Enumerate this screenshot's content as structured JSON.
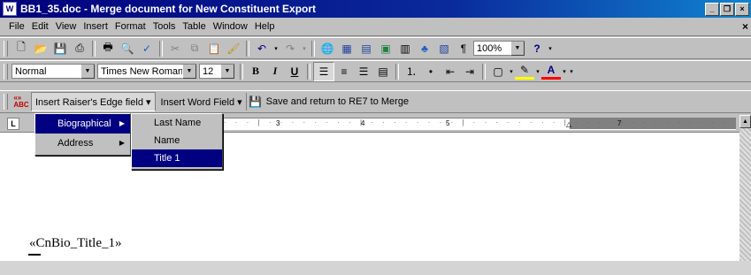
{
  "window": {
    "title": "BB1_35.doc - Merge document for New Constituent Export",
    "app_icon": "W",
    "minimize": "_",
    "maximize": " ",
    "restore": "❐",
    "close": "×"
  },
  "menubar": {
    "items": [
      "File",
      "Edit",
      "View",
      "Insert",
      "Format",
      "Tools",
      "Table",
      "Window",
      "Help"
    ],
    "close": "×"
  },
  "standard_toolbar": {
    "zoom": "100%"
  },
  "formatting_toolbar": {
    "style": "Normal",
    "font": "Times New Roman",
    "size": "12",
    "bold": "B",
    "italic": "I",
    "underline": "U"
  },
  "merge_toolbar": {
    "insert_raisers_edge_field": "Insert Raiser's Edge field ▾",
    "insert_word_field": "Insert Word Field ▾",
    "save_return": "Save and return to RE7 to Merge"
  },
  "ruler": {
    "numbers": [
      "3",
      "4",
      "5",
      "7"
    ]
  },
  "menus": {
    "main": [
      {
        "label": "Biographical",
        "highlighted": true
      },
      {
        "label": "Address",
        "highlighted": false
      }
    ],
    "biographical": [
      {
        "label": "Last Name",
        "highlighted": false
      },
      {
        "label": "Name",
        "highlighted": false
      },
      {
        "label": "Title 1",
        "highlighted": true
      }
    ]
  },
  "document": {
    "merge_field": "«CnBio_Title_1»"
  },
  "colors": {
    "highlight": "#000080",
    "titlebar": "#00007b"
  }
}
